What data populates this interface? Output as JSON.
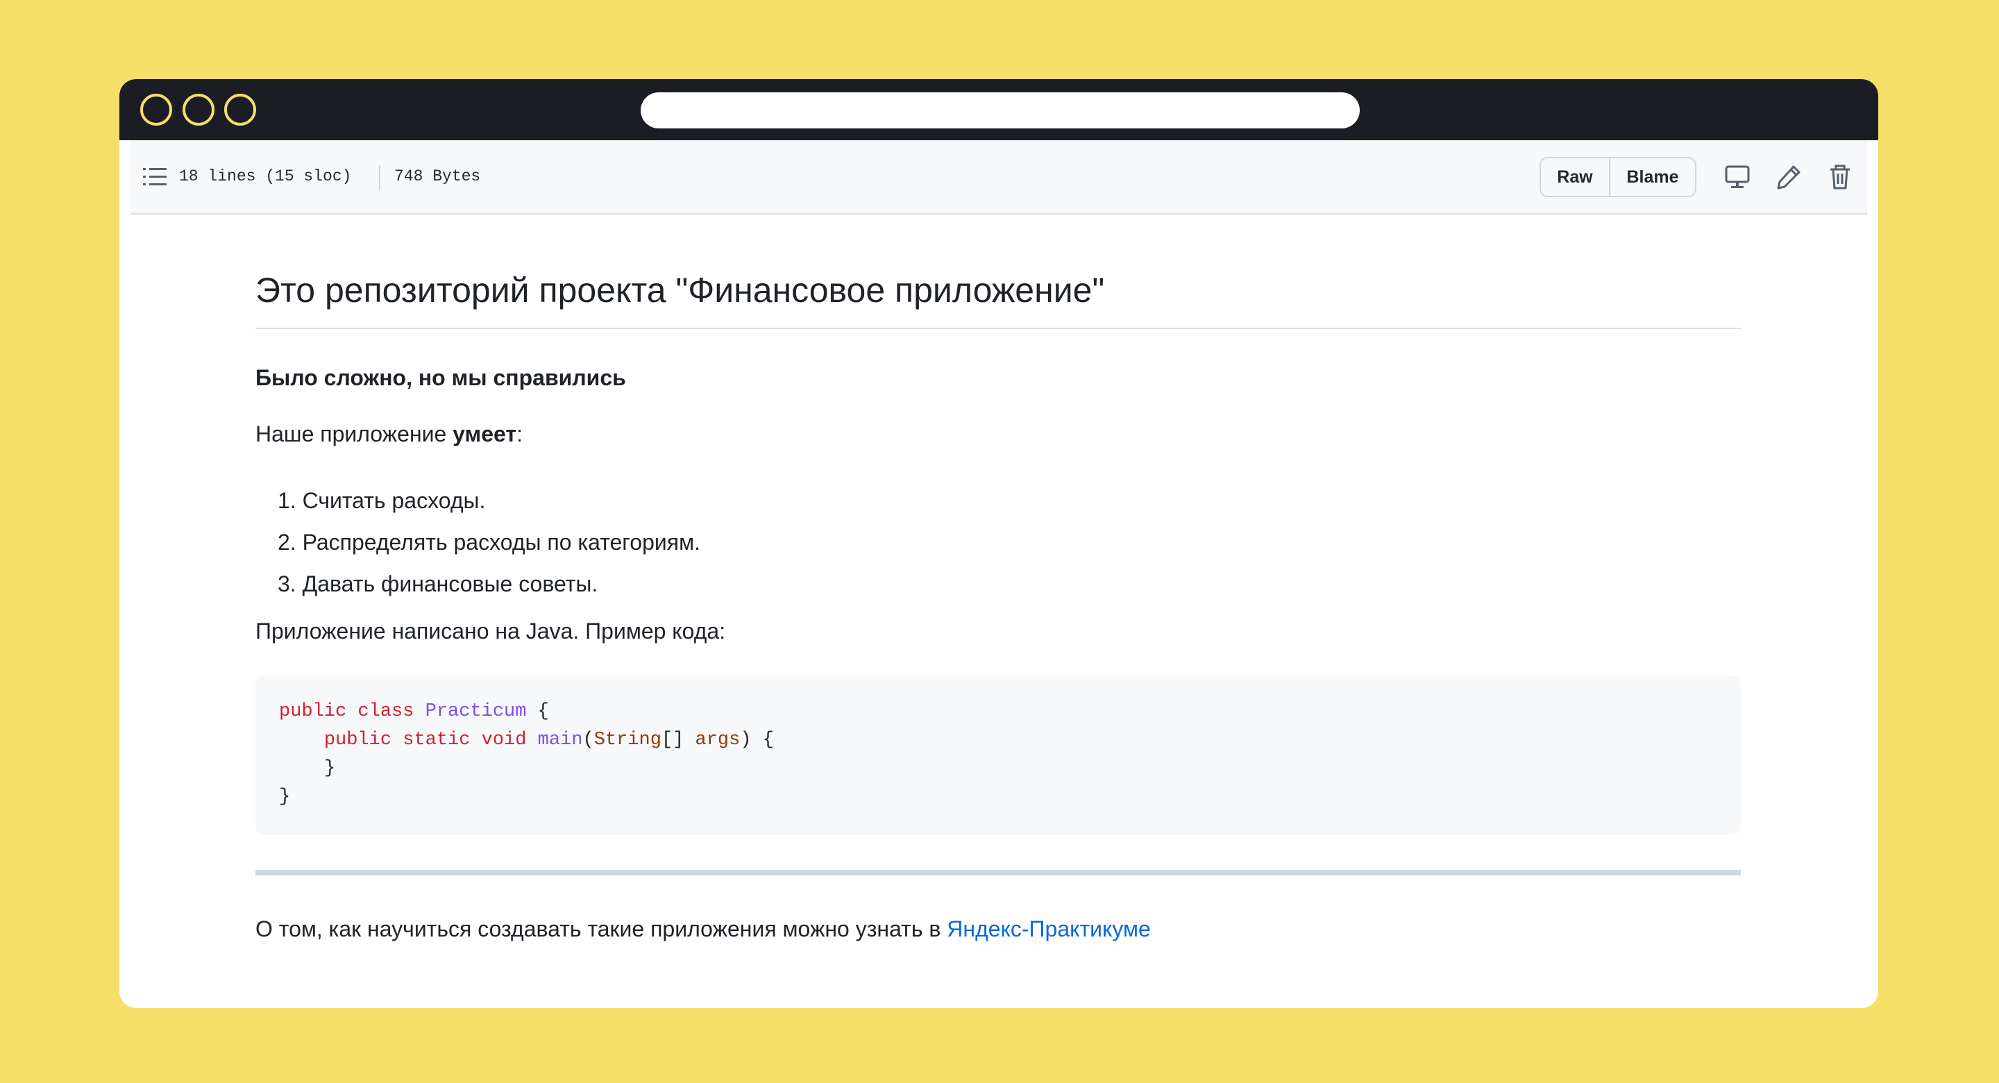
{
  "file_bar": {
    "lines_info": "18 lines (15 sloc)",
    "size_info": "748 Bytes",
    "raw_label": "Raw",
    "blame_label": "Blame",
    "icons": [
      "list-unordered-icon",
      "desktop-icon",
      "pencil-icon",
      "trash-icon"
    ]
  },
  "readme": {
    "title": "Это репозиторий проекта \"Финансовое приложение\"",
    "bold_line": "Было сложно, но мы справились",
    "intro_prefix": "Наше приложение ",
    "intro_bold": "умеет",
    "intro_suffix": ":",
    "list_items": [
      "1. Считать расходы.",
      "2. Распределять расходы по категориям.",
      "3. Давать финансовые советы."
    ],
    "java_line": "Приложение написано на Java. Пример кода:",
    "code": {
      "line1": {
        "kw1": "public",
        "kw2": "class",
        "name": "Practicum",
        "rest": " {"
      },
      "line2": {
        "kw1": "public",
        "kw2": "static",
        "kw3": "void",
        "fn": "main",
        "paren_open": "(",
        "type": "String",
        "brackets": "[] ",
        "arg": "args",
        "rest": ") {"
      },
      "line3": "}",
      "line4": "}"
    },
    "footer_text": "О том, как научиться создавать такие приложения можно узнать в ",
    "footer_link": "Яндекс-Практикуме"
  },
  "colors": {
    "background": "#f5df69",
    "titlebar": "#1b1c24",
    "link": "#0969da",
    "keyword": "#cf222e",
    "class_name": "#8250df"
  }
}
